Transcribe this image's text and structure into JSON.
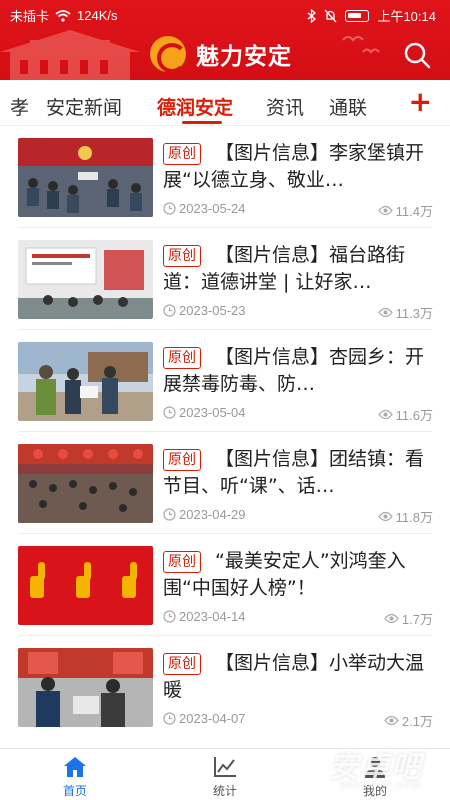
{
  "status_bar": {
    "carrier": "未插卡",
    "speed": "124K/s",
    "time": "上午10:14"
  },
  "header": {
    "title": "魅力安定",
    "accent_color": "#d40e14"
  },
  "tabs": [
    {
      "label": "孝"
    },
    {
      "label": "安定新闻"
    },
    {
      "label": "德润安定",
      "active": true
    },
    {
      "label": "资讯"
    },
    {
      "label": "通联"
    }
  ],
  "tab_add_label": "+",
  "articles": [
    {
      "badge": "原创",
      "title": "【图片信息】李家堡镇开展“以德立身、敬业…",
      "date": "2023-05-24",
      "views": "11.4万"
    },
    {
      "badge": "原创",
      "title": "【图片信息】福台路街道：道德讲堂 | 让好家…",
      "date": "2023-05-23",
      "views": "11.3万"
    },
    {
      "badge": "原创",
      "title": "【图片信息】杏园乡：开展禁毒防毒、防…",
      "date": "2023-05-04",
      "views": "11.6万"
    },
    {
      "badge": "原创",
      "title": "【图片信息】团结镇：看节目、听“课”、话…",
      "date": "2023-04-29",
      "views": "11.8万"
    },
    {
      "badge": "原创",
      "title": "“最美安定人”刘鸿奎入围“中国好人榜”！",
      "date": "2023-04-14",
      "views": "1.7万"
    },
    {
      "badge": "原创",
      "title": "【图片信息】小举动大温暖",
      "date": "2023-04-07",
      "views": "2.1万"
    }
  ],
  "bottom_nav": [
    {
      "label": "首页",
      "icon": "home-icon",
      "active": true
    },
    {
      "label": "统计",
      "icon": "chart-icon"
    },
    {
      "label": "我的",
      "icon": "user-icon"
    }
  ],
  "watermark": {
    "main": "安卓吧",
    "sub": "anzhuo8.com"
  }
}
